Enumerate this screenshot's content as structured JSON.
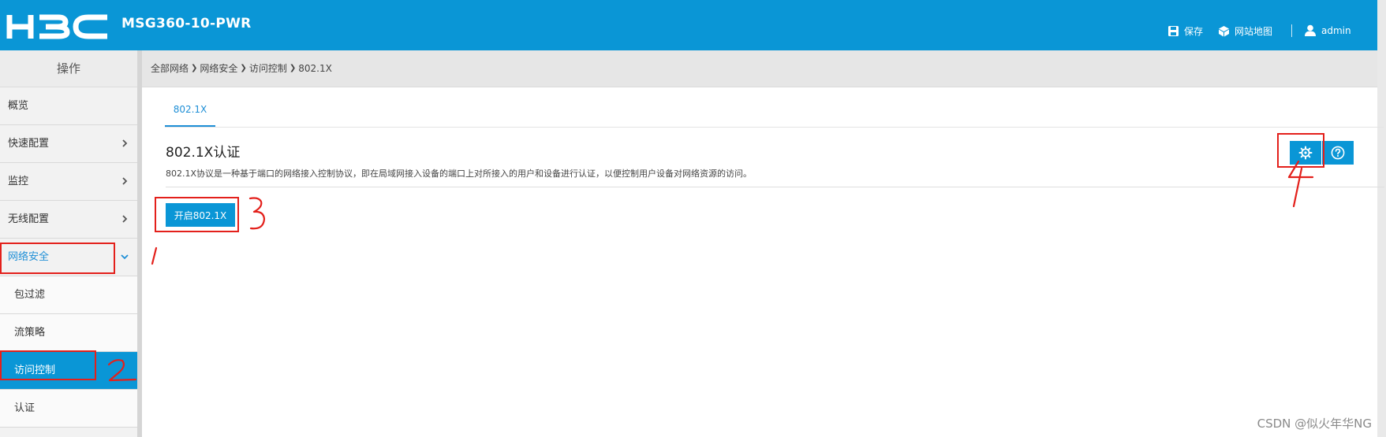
{
  "header": {
    "brand": "H3C",
    "model": "MSG360-10-PWR",
    "save_label": "保存",
    "sitemap_label": "网站地图",
    "user_label": "admin",
    "bg_color": "#0a96d6"
  },
  "sidebar": {
    "title": "操作",
    "items": [
      {
        "label": "概览",
        "expandable": false
      },
      {
        "label": "快速配置",
        "expandable": true
      },
      {
        "label": "监控",
        "expandable": true
      },
      {
        "label": "无线配置",
        "expandable": true
      },
      {
        "label": "网络安全",
        "expandable": true,
        "expanded": true
      }
    ],
    "sub_items": [
      {
        "label": "包过滤"
      },
      {
        "label": "流策略"
      },
      {
        "label": "访问控制",
        "selected": true
      },
      {
        "label": "认证"
      }
    ]
  },
  "breadcrumb": [
    "全部网络",
    "网络安全",
    "访问控制",
    "802.1X"
  ],
  "main": {
    "tab_label": "802.1X",
    "section_title": "802.1X认证",
    "section_desc": "802.1X协议是一种基于端口的网络接入控制协议，即在局域网接入设备的端口上对所接入的用户和设备进行认证，以便控制用户设备对网络资源的访问。",
    "enable_button": "开启802.1X",
    "settings_icon": "gear-icon",
    "help_icon": "help-circle-icon"
  },
  "annotations": [
    "1",
    "2",
    "3",
    "4"
  ],
  "watermark": "CSDN @似火年华NG"
}
